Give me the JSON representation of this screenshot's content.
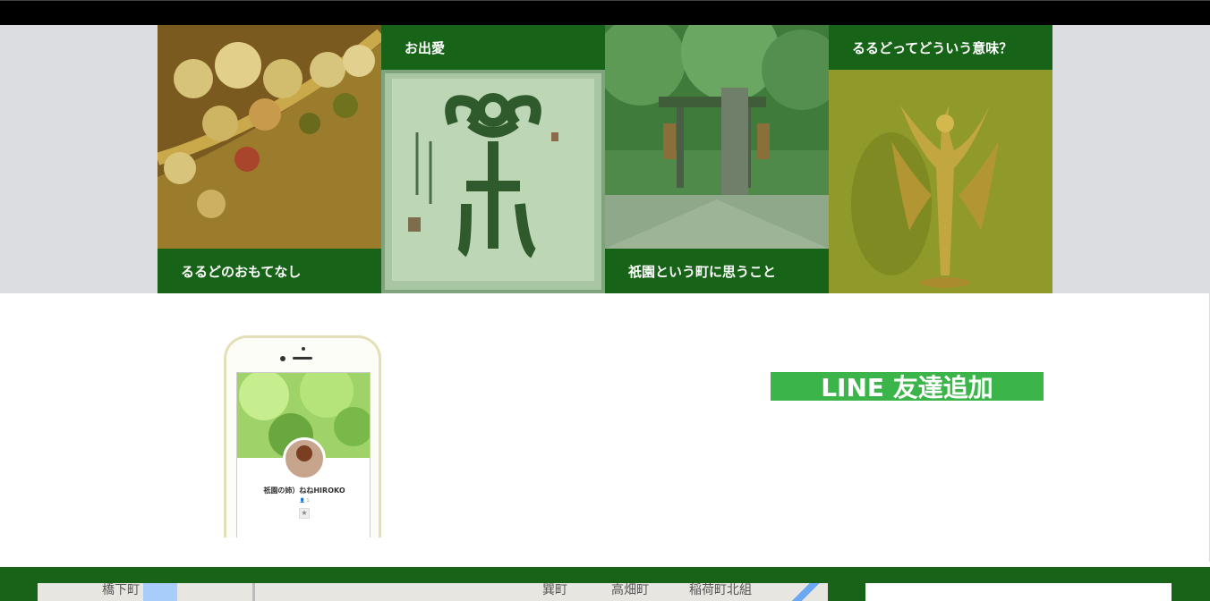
{
  "tiles": [
    {
      "label": "るるどのおもてなし",
      "label_position": "bottom",
      "image": "flowers-photo"
    },
    {
      "label": "お出愛",
      "label_position": "top",
      "image": "calligraphy-photo"
    },
    {
      "label": "祇園という町に思うこと",
      "label_position": "bottom",
      "image": "shrine-photo"
    },
    {
      "label": "るるどってどういう意味？",
      "label_position": "top",
      "image": "angel-statue-photo"
    }
  ],
  "line_profile": {
    "name": "祇園の姉）ねねHIROKO",
    "sub": "👤 1"
  },
  "line_button": {
    "label": "LINE 友達追加"
  },
  "map": {
    "place_labels": [
      "橋下町",
      "巽町",
      "高畑町",
      "稲荷町北組"
    ]
  },
  "colors": {
    "brand_green": "#176317",
    "line_green": "#3bb54a",
    "band_gray": "#dcdde0"
  }
}
